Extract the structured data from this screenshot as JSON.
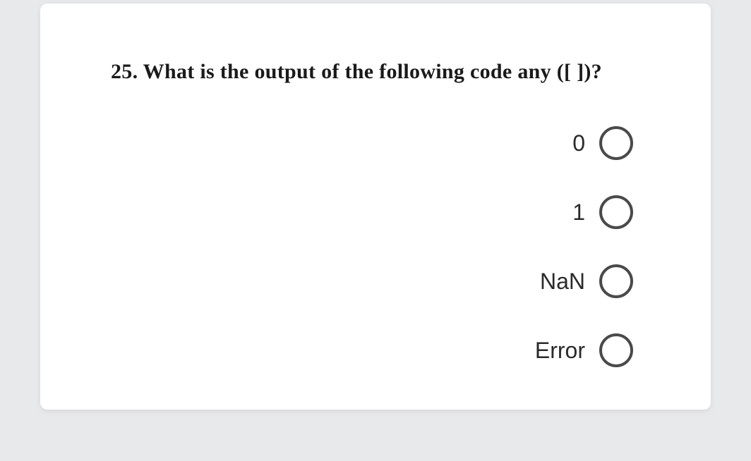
{
  "question": {
    "number": "25.",
    "text": "What is the output of the following code any ([ ])?"
  },
  "options": [
    {
      "label": "0"
    },
    {
      "label": "1"
    },
    {
      "label": "NaN"
    },
    {
      "label": "Error"
    }
  ]
}
